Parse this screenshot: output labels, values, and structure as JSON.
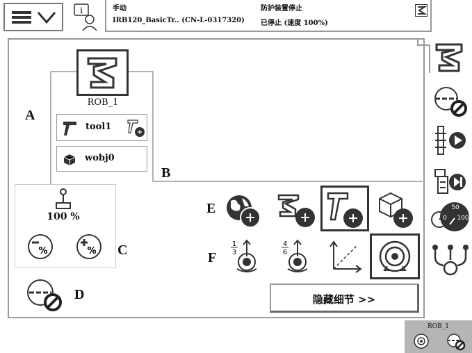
{
  "header": {
    "mode": "手动",
    "controller": "IRB120_BasicTr.. (CN-L-0317320)",
    "guard_status": "防护装置停止",
    "run_status": "已停止 (速度 100%)"
  },
  "mechanical_unit": {
    "name": "ROB_1",
    "tool": "tool1",
    "wobj": "wobj0"
  },
  "speed": {
    "value": "100 %"
  },
  "markers": {
    "A": "A",
    "B": "B",
    "C": "C",
    "D": "D",
    "E": "E",
    "F": "F"
  },
  "hide_details_button": "隐藏细节 >>",
  "increment_labels": {
    "low": "1/3",
    "high": "4/6"
  },
  "speedometer": {
    "min": "0",
    "mid": "50",
    "max": "100"
  },
  "status_bar": {
    "unit": "ROB_1"
  }
}
